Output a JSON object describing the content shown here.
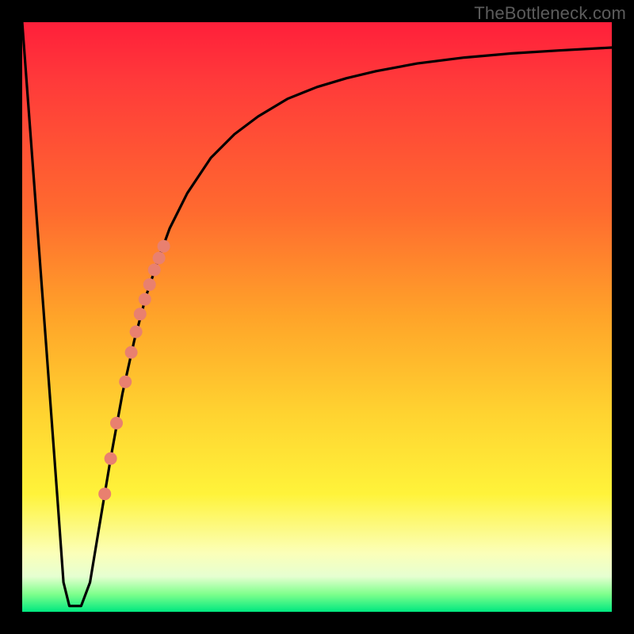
{
  "watermark": "TheBottleneck.com",
  "chart_data": {
    "type": "line",
    "title": "",
    "xlabel": "",
    "ylabel": "",
    "xlim": [
      0,
      100
    ],
    "ylim": [
      0,
      100
    ],
    "background_gradient": {
      "orientation": "vertical",
      "stops": [
        {
          "pct": 0,
          "color": "#ff1f3a"
        },
        {
          "pct": 10,
          "color": "#ff3a3a"
        },
        {
          "pct": 32,
          "color": "#ff6a2f"
        },
        {
          "pct": 50,
          "color": "#ffa429"
        },
        {
          "pct": 66,
          "color": "#ffd230"
        },
        {
          "pct": 80,
          "color": "#fff33a"
        },
        {
          "pct": 90,
          "color": "#fbffb8"
        },
        {
          "pct": 94,
          "color": "#e6ffd1"
        },
        {
          "pct": 97,
          "color": "#7fff8c"
        },
        {
          "pct": 100,
          "color": "#00e880"
        }
      ]
    },
    "series": [
      {
        "name": "bottleneck-curve",
        "color": "#000000",
        "x": [
          0.0,
          2.0,
          4.0,
          6.0,
          7.0,
          8.0,
          10.0,
          11.5,
          13.0,
          15.0,
          17.0,
          19.0,
          21.0,
          23.0,
          25.0,
          28.0,
          32.0,
          36.0,
          40.0,
          45.0,
          50.0,
          55.0,
          60.0,
          67.0,
          75.0,
          83.0,
          91.0,
          100.0
        ],
        "y": [
          100.0,
          73.0,
          46.0,
          19.0,
          5.0,
          1.0,
          1.0,
          5.0,
          14.0,
          26.0,
          37.0,
          46.0,
          53.5,
          59.5,
          65.0,
          71.0,
          77.0,
          81.0,
          84.0,
          87.0,
          89.0,
          90.5,
          91.7,
          93.0,
          94.0,
          94.7,
          95.2,
          95.7
        ]
      }
    ],
    "markers": {
      "name": "highlighted-range",
      "shape": "circle",
      "color": "#e9806f",
      "radius_px": 8,
      "points": [
        {
          "x": 14.0,
          "y": 20.0
        },
        {
          "x": 15.0,
          "y": 26.0
        },
        {
          "x": 16.0,
          "y": 32.0
        },
        {
          "x": 17.5,
          "y": 39.0
        },
        {
          "x": 18.5,
          "y": 44.0
        },
        {
          "x": 19.3,
          "y": 47.5
        },
        {
          "x": 20.0,
          "y": 50.5
        },
        {
          "x": 20.8,
          "y": 53.0
        },
        {
          "x": 21.6,
          "y": 55.5
        },
        {
          "x": 22.4,
          "y": 58.0
        },
        {
          "x": 23.2,
          "y": 60.0
        },
        {
          "x": 24.0,
          "y": 62.0
        }
      ]
    }
  }
}
